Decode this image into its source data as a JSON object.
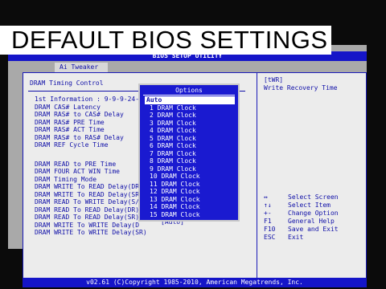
{
  "caption": "DEFAULT BIOS SETTINGS",
  "bios": {
    "title": "BIOS SETUP UTILITY",
    "tab": "Ai Tweaker",
    "section_title": "DRAM Timing Control",
    "settings": [
      "1st Information : 9-9-9-24-",
      "DRAM CAS# Latency",
      "DRAM RAS# to CAS# Delay",
      "DRAM RAS# PRE Time",
      "DRAM RAS# ACT Time",
      "DRAM RAS# to RAS# Delay",
      "DRAM REF Cycle Time",
      "",
      "DRAM READ to PRE Time",
      "DRAM FOUR ACT WIN Time",
      "DRAM Timing Mode",
      "DRAM WRITE To READ Delay(DR",
      "DRAM WRITE To READ Delay(SR",
      "DRAM READ To WRITE Delay(S/",
      "DRAM READ To READ Delay(DR)",
      "DRAM READ To READ Delay(SR)",
      "DRAM WRITE To WRITE Delay(D",
      "DRAM WRITE To WRITE Delay(SR)"
    ],
    "current_value": "[Auto]",
    "help": {
      "tag": "[tWR]",
      "text": "Write Recovery Time"
    },
    "keys": [
      {
        "key": "↔",
        "action": "Select Screen"
      },
      {
        "key": "↑↓",
        "action": "Select Item"
      },
      {
        "key": "+-",
        "action": "Change Option"
      },
      {
        "key": "F1",
        "action": "General Help"
      },
      {
        "key": "F10",
        "action": "Save and Exit"
      },
      {
        "key": "ESC",
        "action": "Exit"
      }
    ],
    "footer": "v02.61 (C)Copyright 1985-2010, American Megatrends, Inc.",
    "popup": {
      "title": "Options",
      "options": [
        "Auto",
        "1 DRAM Clock",
        "2 DRAM Clock",
        "3 DRAM Clock",
        "4 DRAM Clock",
        "5 DRAM Clock",
        "6 DRAM Clock",
        "7 DRAM Clock",
        "8 DRAM Clock",
        "9 DRAM Clock",
        "10 DRAM Clock",
        "11 DRAM Clock",
        "12 DRAM Clock",
        "13 DRAM Clock",
        "14 DRAM Clock",
        "15 DRAM Clock"
      ],
      "selected": "Auto"
    }
  }
}
